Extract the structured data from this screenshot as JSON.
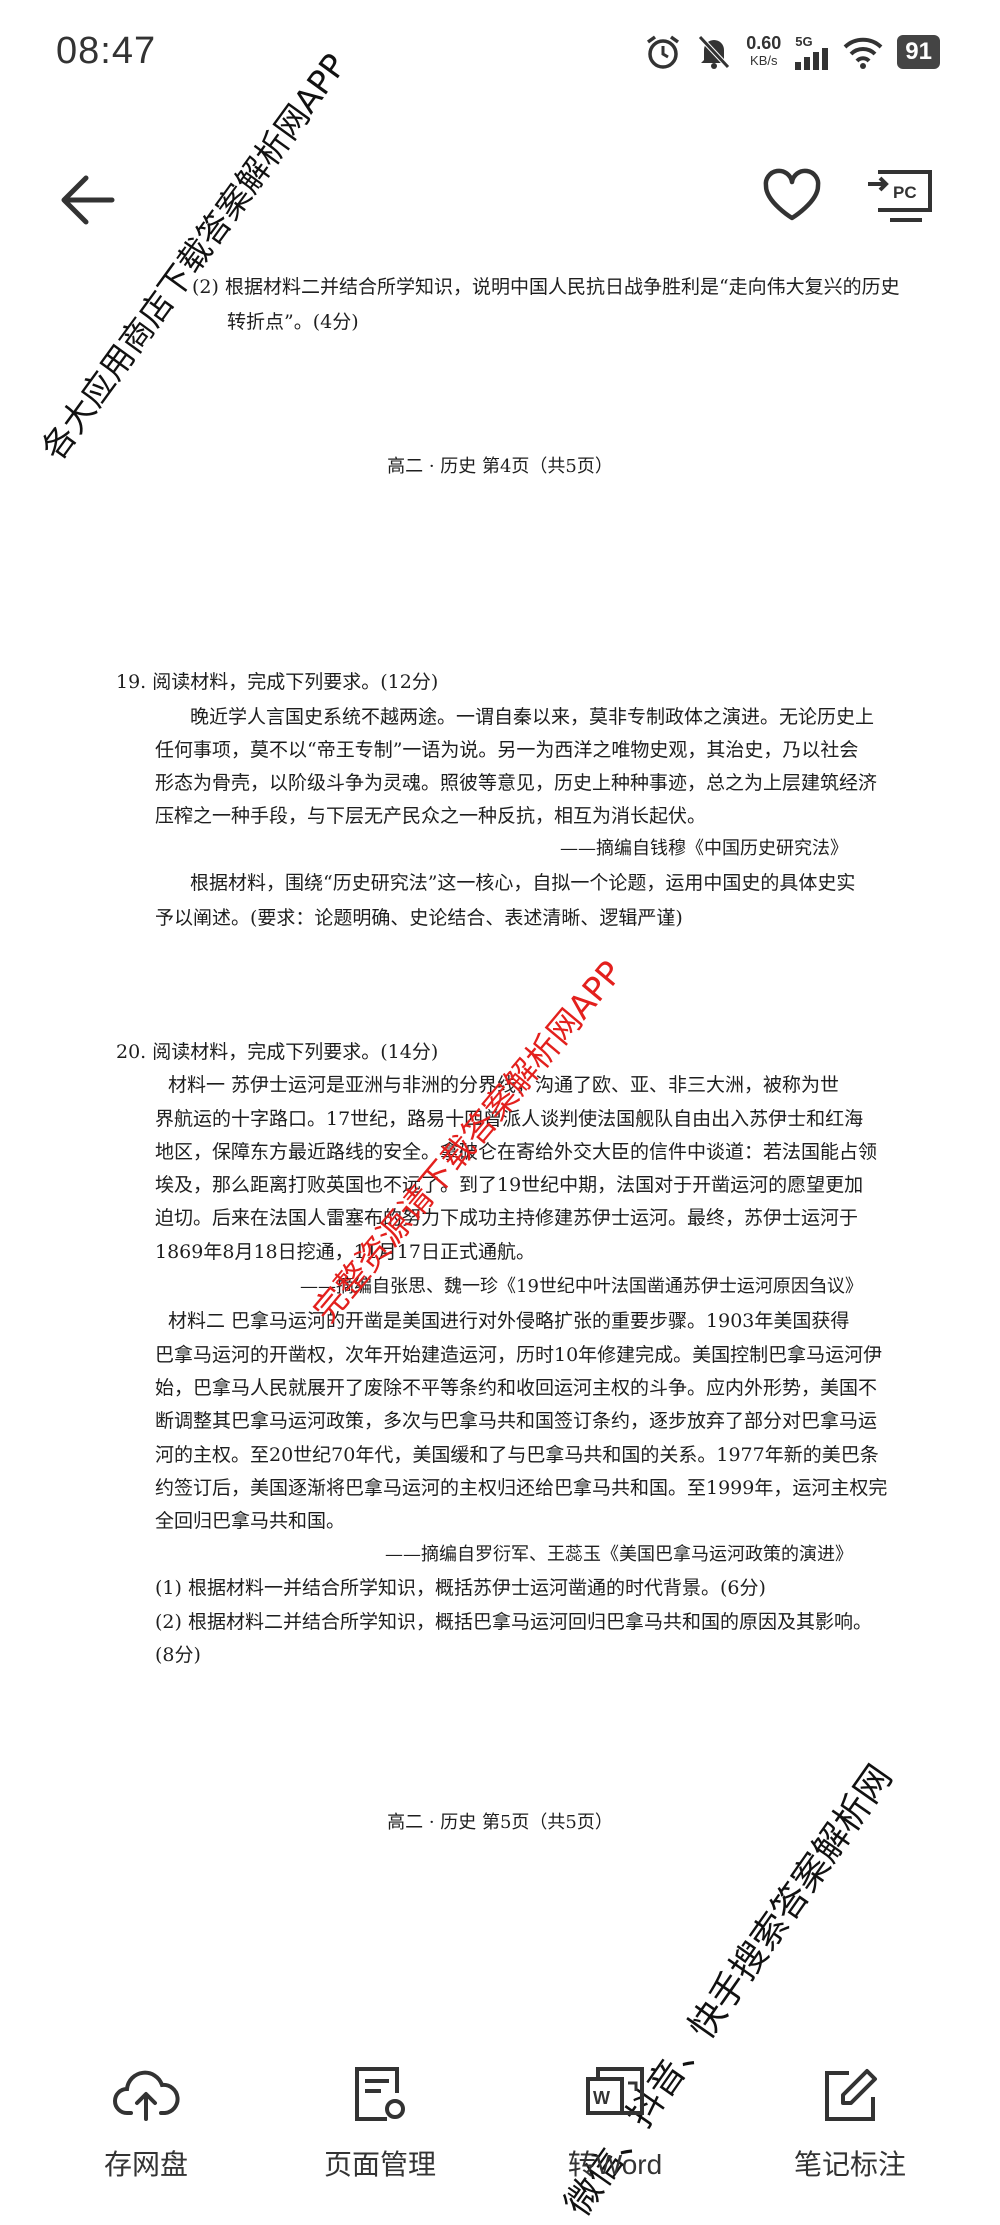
{
  "status": {
    "time": "08:47",
    "net_speed": "0.60",
    "net_unit": "KB/s",
    "signal_label": "5G",
    "battery": "91"
  },
  "doc": {
    "q_tail_line1": "(2) 根据材料二并结合所学知识，说明中国人民抗日战争胜利是“走向伟大复兴的历史",
    "q_tail_line2": "转折点”。(4分)",
    "footer4": "高二 · 历史   第4页（共5页）",
    "q19_head": "19. 阅读材料，完成下列要求。(12分)",
    "q19_lines": [
      "晚近学人言国史系统不越两途。一谓自秦以来，莫非专制政体之演进。无论历史上",
      "任何事项，莫不以“帝王专制”一语为说。另一为西洋之唯物史观，其治史，乃以社会",
      "形态为骨壳，以阶级斗争为灵魂。照彼等意见，历史上种种事迹，总之为上层建筑经济",
      "压榨之一种手段，与下层无产民众之一种反抗，相互为消长起伏。"
    ],
    "q19_source": "——摘编自钱穆《中国历史研究法》",
    "q19_req_line1": "根据材料，围绕“历史研究法”这一核心，自拟一个论题，运用中国史的具体史实",
    "q19_req_line2": "予以阐述。(要求：论题明确、史论结合、表述清晰、逻辑严谨)",
    "q20_head": "20. 阅读材料，完成下列要求。(14分)",
    "q20_m1_lines": [
      "材料一  苏伊士运河是亚洲与非洲的分界线，沟通了欧、亚、非三大洲，被称为世",
      "界航运的十字路口。17世纪，路易十四曾派人谈判使法国舰队自由出入苏伊士和红海",
      "地区，保障东方最近路线的安全。拿破仑在寄给外交大臣的信件中谈道：若法国能占领",
      "埃及，那么距离打败英国也不远了。到了19世纪中期，法国对于开凿运河的愿望更加",
      "迫切。后来在法国人雷塞布的努力下成功主持修建苏伊士运河。最终，苏伊士运河于",
      "1869年8月18日挖通，11月17日正式通航。"
    ],
    "q20_m1_source": "——摘编自张思、魏一珍《19世纪中叶法国凿通苏伊士运河原因刍议》",
    "q20_m2_lines": [
      "材料二  巴拿马运河的开凿是美国进行对外侵略扩张的重要步骤。1903年美国获得",
      "巴拿马运河的开凿权，次年开始建造运河，历时10年修建完成。美国控制巴拿马运河伊",
      "始，巴拿马人民就展开了废除不平等条约和收回运河主权的斗争。应内外形势，美国不",
      "断调整其巴拿马运河政策，多次与巴拿马共和国签订条约，逐步放弃了部分对巴拿马运",
      "河的主权。至20世纪70年代，美国缓和了与巴拿马共和国的关系。1977年新的美巴条",
      "约签订后，美国逐渐将巴拿马运河的主权归还给巴拿马共和国。至1999年，运河主权完",
      "全回归巴拿马共和国。"
    ],
    "q20_m2_source": "——摘编自罗衍军、王蕊玉《美国巴拿马运河政策的演进》",
    "q20_req1": "(1) 根据材料一并结合所学知识，概括苏伊士运河凿通的时代背景。(6分)",
    "q20_req2_line1": "(2) 根据材料二并结合所学知识，概括巴拿马运河回归巴拿马共和国的原因及其影响。",
    "q20_req2_line2": "(8分)",
    "footer5": "高二 · 历史   第5页（共5页）"
  },
  "toolbar": {
    "cloud": "存网盘",
    "page_manage": "页面管理",
    "to_word": "转Word",
    "notes": "笔记标注"
  },
  "watermarks": {
    "top_left": "各大应用商店下载答案解析网APP",
    "center": "完整资源请下载答案解析网APP",
    "bottom_right": "微信、抖音、快手搜索答案解析网"
  },
  "colors": {
    "watermark_red": "#e3201d",
    "text": "#1a1a1a"
  }
}
